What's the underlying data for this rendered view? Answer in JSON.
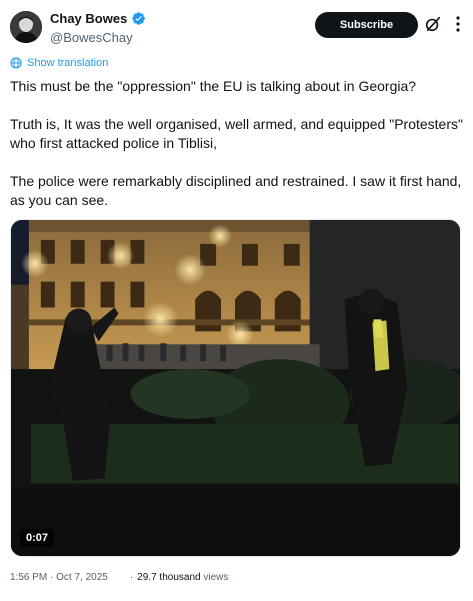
{
  "author": {
    "display_name": "Chay Bowes",
    "handle": "@BowesChay",
    "verified": true,
    "avatar_icon": "profile-photo"
  },
  "header": {
    "subscribe_label": "Subscribe",
    "grok_icon": "grok-icon",
    "more_icon": "more-icon"
  },
  "translation": {
    "label": "Show translation",
    "icon": "globe-icon"
  },
  "tweet": {
    "lines": [
      "This must be the  \"oppression\" the EU is talking about in Georgia?",
      "Truth is, It was the well organised, well armed, and equipped \"Protesters\" who first attacked police in Tiblisi,",
      "The police were remarkably disciplined and restrained. I saw it first hand, as you can see."
    ]
  },
  "media": {
    "type": "video",
    "duration": "0:07"
  },
  "footer": {
    "time_date": "1:56 PM · Oct 7, 2025",
    "separator": "·",
    "views_count": "29.7 thousand",
    "views_label": "views"
  },
  "colors": {
    "accent": "#1d9bf0",
    "text": "#0f1419",
    "muted": "#536471",
    "button_bg": "#0f1419"
  }
}
